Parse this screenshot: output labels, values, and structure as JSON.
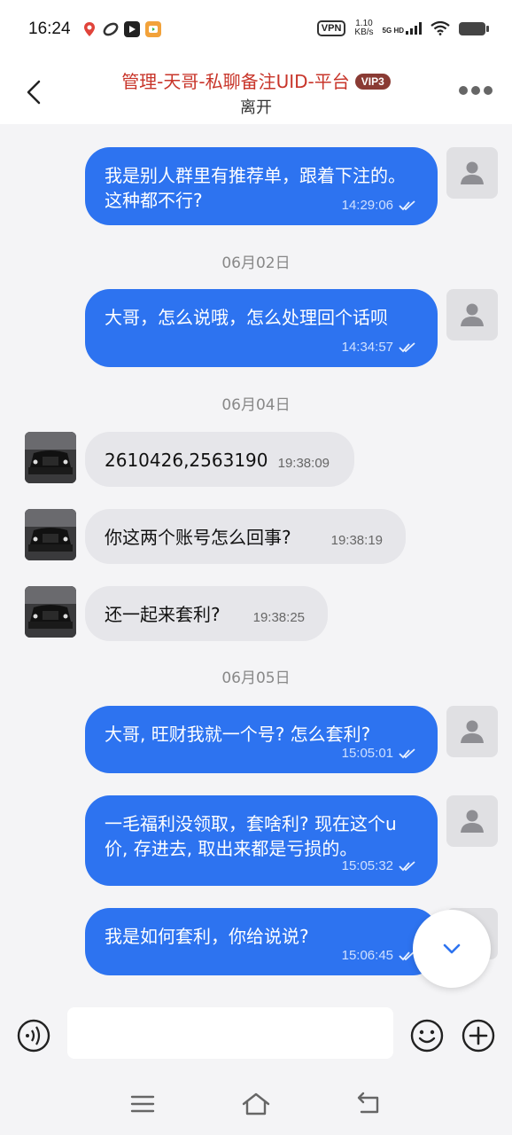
{
  "status": {
    "time": "16:24",
    "vpn": "VPN",
    "netspeed_value": "1.10",
    "netspeed_unit": "KB/s",
    "signal_label": "5G HD"
  },
  "header": {
    "title": "管理-天哥-私聊备注UID-平台",
    "badge": "VIP3",
    "subtitle": "离开"
  },
  "messages": [
    {
      "dir": "out",
      "text": "我是别人群里有推荐单，跟着下注的。这种都不行?",
      "time": "14:29:06"
    },
    {
      "type": "date",
      "text": "06月02日"
    },
    {
      "dir": "out",
      "text": "大哥，怎么说哦，怎么处理回个话呗",
      "time": "14:34:57"
    },
    {
      "type": "date",
      "text": "06月04日"
    },
    {
      "dir": "in",
      "text": "2610426,2563190",
      "time": "19:38:09"
    },
    {
      "dir": "in",
      "text": "你这两个账号怎么回事?",
      "time": "19:38:19"
    },
    {
      "dir": "in",
      "text": "还一起来套利?",
      "time": "19:38:25"
    },
    {
      "type": "date",
      "text": "06月05日"
    },
    {
      "dir": "out",
      "text": "大哥, 旺财我就一个号? 怎么套利?",
      "time": "15:05:01"
    },
    {
      "dir": "out",
      "text": "一毛福利没领取，套啥利? 现在这个u价, 存进去, 取出来都是亏损的。",
      "time": "15:05:32"
    },
    {
      "dir": "out",
      "text": "我是如何套利，你给说说?",
      "time": "15:06:45"
    }
  ],
  "input": {
    "placeholder": ""
  },
  "colors": {
    "outgoing_bubble": "#2d73f0",
    "incoming_bubble": "#e6e6ea",
    "title": "#c8352a",
    "badge": "#8a3b34"
  }
}
